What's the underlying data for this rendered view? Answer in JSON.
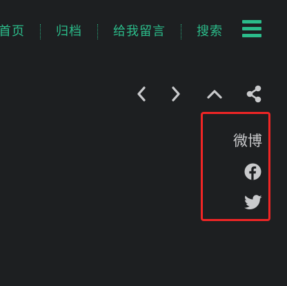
{
  "nav": {
    "items": [
      {
        "label": "首页"
      },
      {
        "label": "归档"
      },
      {
        "label": "给我留言"
      },
      {
        "label": "搜索"
      }
    ],
    "menu_icon": "hamburger-menu-icon",
    "color": "#2bbc8a"
  },
  "actions": {
    "icons": [
      "chevron-left-icon",
      "chevron-right-icon",
      "chevron-up-icon",
      "share-icon"
    ],
    "color": "#c9cacc"
  },
  "share": {
    "weibo_label": "微博",
    "facebook_icon": "facebook-icon",
    "twitter_icon": "twitter-icon",
    "highlight_color": "#f02525"
  },
  "theme": {
    "background": "#1d1f21",
    "accent": "#2bbc8a"
  }
}
